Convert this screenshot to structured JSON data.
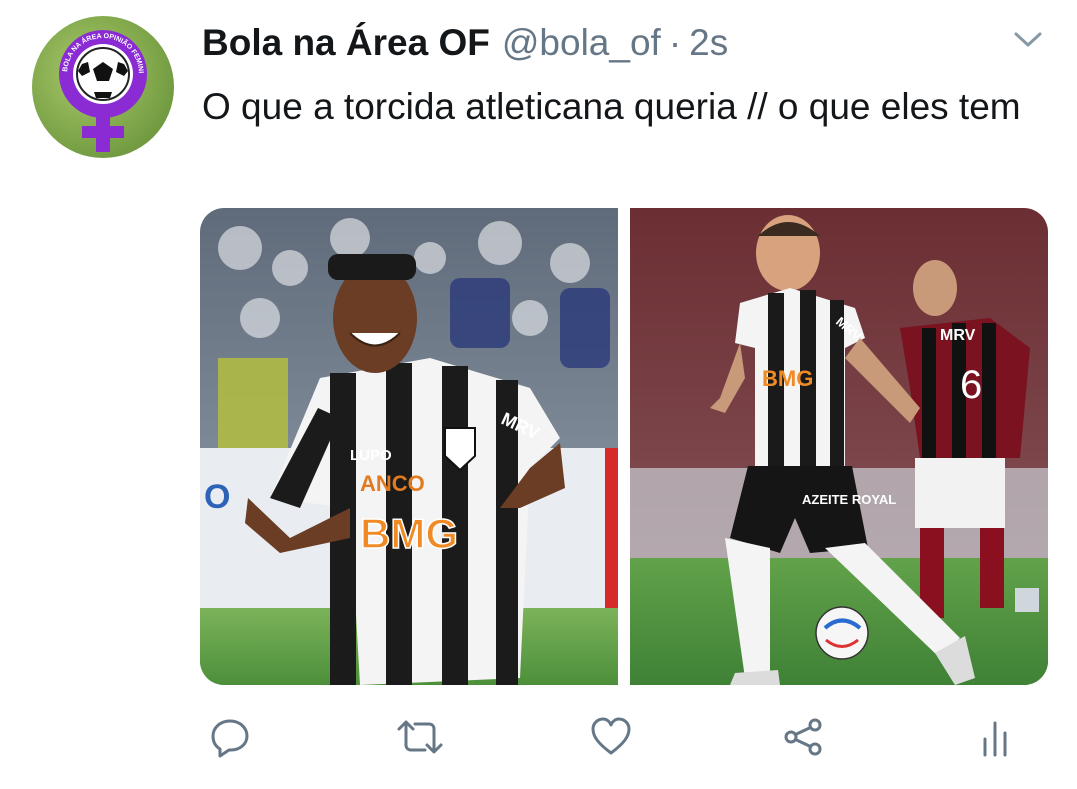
{
  "tweet": {
    "author_name": "Bola na Área OF",
    "handle": "@bola_of",
    "separator": "·",
    "timestamp": "2s",
    "text": "O que a torcida atleticana queria // o que eles tem",
    "avatar_text": "BOLA NA ÁREA OPINIÃO FEMININA"
  },
  "media": {
    "left_shirt_sponsor": "BMG",
    "left_shirt_sponsor_top": "ANCO",
    "left_shirt_brand": "MRV",
    "left_shirt_maker": "LUPO",
    "right_shirt_sponsor": "BMG",
    "right_shirt_sleeve": "MRV",
    "right_shorts_sponsor": "AZEITE ROYAL",
    "right_opponent_number": "6",
    "right_opponent_sponsor": "MRV"
  },
  "actions": [
    {
      "name": "reply",
      "icon": "reply-icon"
    },
    {
      "name": "retweet",
      "icon": "retweet-icon"
    },
    {
      "name": "like",
      "icon": "heart-icon"
    },
    {
      "name": "share",
      "icon": "share-icon"
    },
    {
      "name": "analytics",
      "icon": "analytics-icon"
    }
  ],
  "colors": {
    "text": "#14171a",
    "secondary": "#657786",
    "avatar_purple": "#8a2bd4"
  }
}
